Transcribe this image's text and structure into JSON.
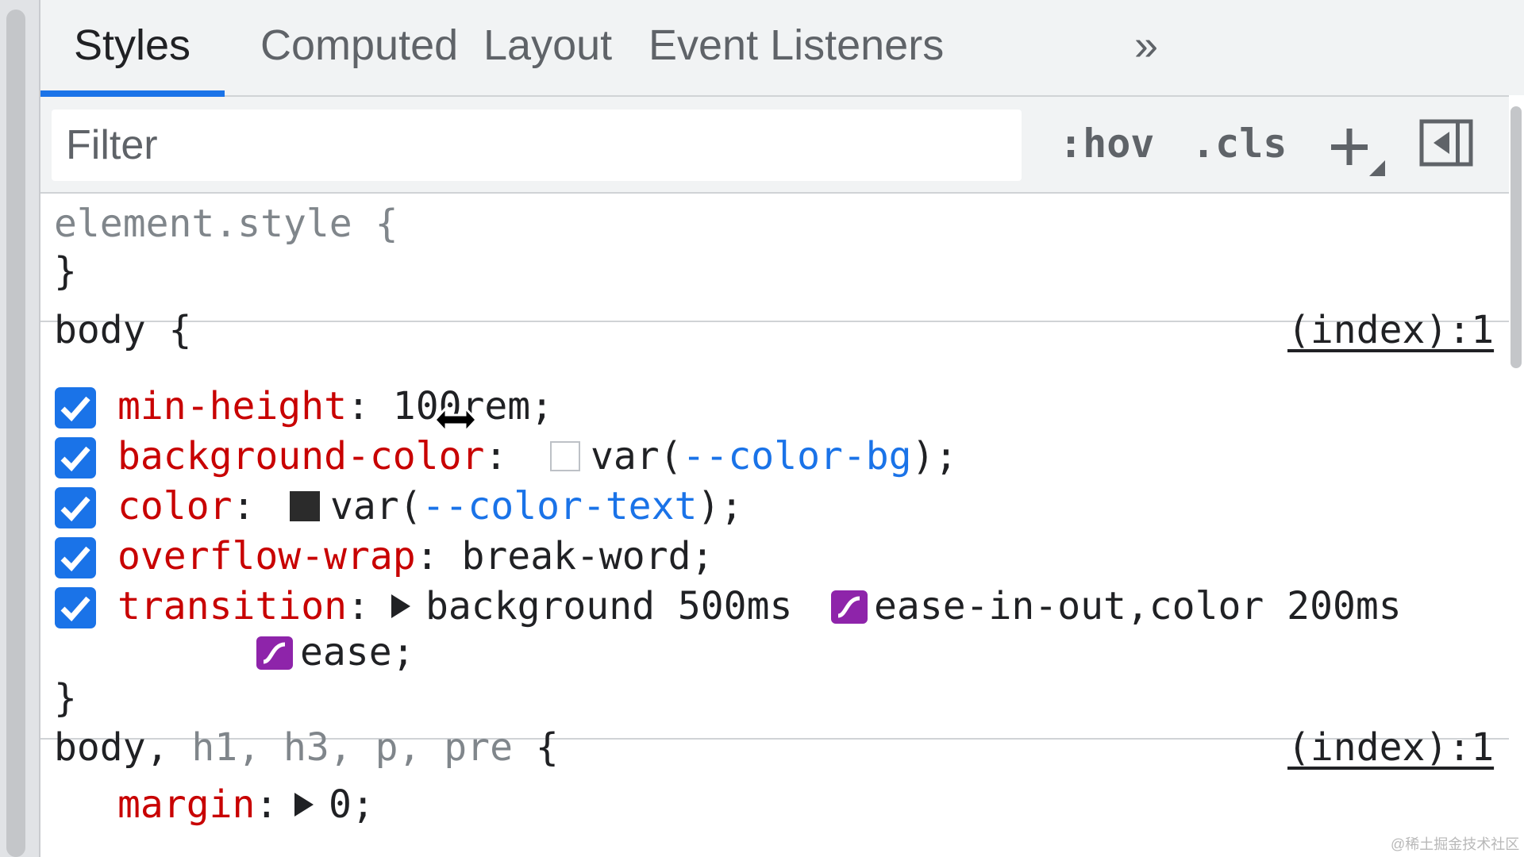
{
  "tabs": [
    {
      "label": "Styles",
      "active": true
    },
    {
      "label": "Computed"
    },
    {
      "label": "Layout"
    },
    {
      "label": "Event Listeners"
    }
  ],
  "more_tabs_label": "»",
  "toolbar": {
    "filter_placeholder": "Filter",
    "hov_label": ":hov",
    "cls_label": ".cls",
    "add_rule_icon": "plus-icon",
    "toggle_sidebar_icon": "sidebar-toggle-icon"
  },
  "rules": {
    "element_style": {
      "selector": "element.style {",
      "close": "}"
    },
    "body": {
      "selector": "body {",
      "source": "(index):1",
      "close": "}",
      "min_height": {
        "name": "min-height",
        "value_a": "10",
        "value_b": "0rem;"
      },
      "background_color": {
        "name": "background-color",
        "var_open": "var(",
        "var_name": "--color-bg",
        "var_close": ");",
        "swatch_color": "#ffffff"
      },
      "color": {
        "name": "color",
        "var_open": "var(",
        "var_name": "--color-text",
        "var_close": ");",
        "swatch_color": "#2b2b2b"
      },
      "overflow_wrap": {
        "name": "overflow-wrap",
        "value": "break-word;"
      },
      "transition": {
        "name": "transition",
        "value_1": "background 500ms",
        "value_2": "ease-in-out,color 200ms",
        "value_3": "ease;"
      }
    },
    "body_group": {
      "selector_main": "body,",
      "selector_rest": " h1, h3, p, pre",
      "selector_brace": " {",
      "source": "(index):1",
      "margin": {
        "name": "margin",
        "value": "0;"
      }
    }
  },
  "colon": ":",
  "watermark": "@稀土掘金技术社区",
  "colors": {
    "accent": "#1a73e8",
    "property": "#c80000",
    "easing": "#8e24aa"
  }
}
